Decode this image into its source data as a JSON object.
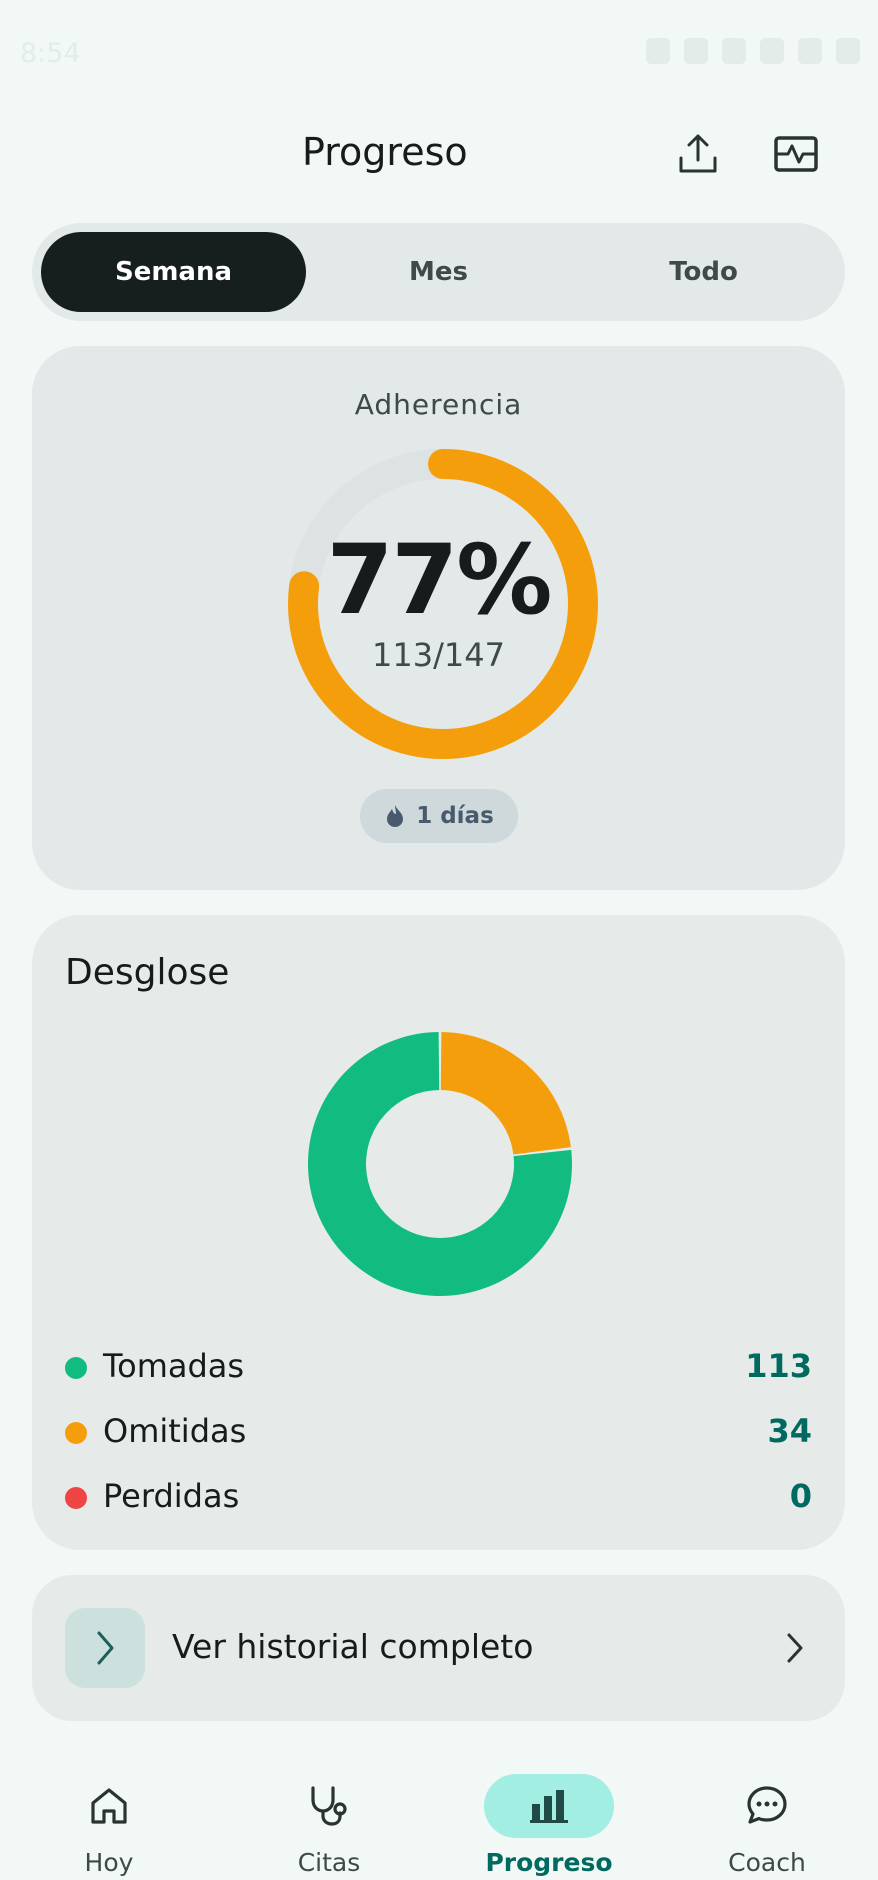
{
  "status_bar": {
    "time": "8:54"
  },
  "header": {
    "title": "Progreso",
    "share_icon": "share-upload-icon",
    "compare_icon": "compare-vitals-icon"
  },
  "period_tabs": {
    "items": [
      {
        "label": "Semana",
        "active": true
      },
      {
        "label": "Mes",
        "active": false
      },
      {
        "label": "Todo",
        "active": false
      }
    ]
  },
  "adherence": {
    "label": "Adherencia",
    "percent_text": "77%",
    "percent": 0.77,
    "count_text": "113/147",
    "taken": 113,
    "total": 147,
    "streak_text": "1 días",
    "streak_icon": "flame-icon",
    "ring_color": "#f59e0b",
    "track_color": "#dce3e2"
  },
  "breakdown": {
    "title": "Desglose",
    "items": [
      {
        "label": "Tomadas",
        "value": "113",
        "color": "#12bb80"
      },
      {
        "label": "Omitidas",
        "value": "34",
        "color": "#f59e0b"
      },
      {
        "label": "Perdidas",
        "value": "0",
        "color": "#ef4444"
      }
    ]
  },
  "history": {
    "label": "Ver historial completo",
    "icon": "chevron-right-icon"
  },
  "bottom_nav": {
    "items": [
      {
        "label": "Hoy",
        "icon": "home-icon",
        "active": false
      },
      {
        "label": "Citas",
        "icon": "stethoscope-icon",
        "active": false
      },
      {
        "label": "Progreso",
        "icon": "bar-chart-icon",
        "active": true
      },
      {
        "label": "Coach",
        "icon": "chat-bubble-icon",
        "active": false
      }
    ]
  }
}
